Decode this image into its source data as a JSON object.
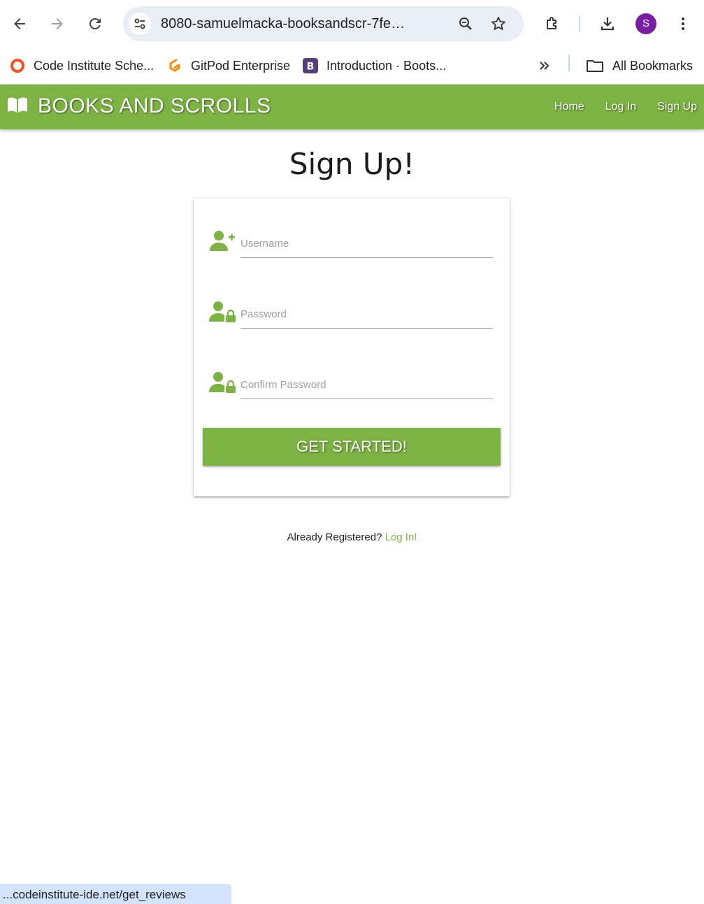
{
  "browser": {
    "url": "8080-samuelmacka-booksandscr-7fenczjre...",
    "profile_initial": "S",
    "bookmarks": [
      {
        "label": "Code Institute Sche...",
        "icon": "code-institute-icon"
      },
      {
        "label": "GitPod Enterprise",
        "icon": "gitpod-icon"
      },
      {
        "label": "Introduction · Boots...",
        "icon": "bootstrap-icon"
      }
    ],
    "all_bookmarks_label": "All Bookmarks",
    "status_url": "...codeinstitute-ide.net/get_reviews"
  },
  "site": {
    "brand": "BOOKS AND SCROLLS",
    "nav": [
      {
        "label": "Home"
      },
      {
        "label": "Log In"
      },
      {
        "label": "Sign Up"
      }
    ],
    "accent_color": "#7cb342"
  },
  "form": {
    "title": "Sign Up!",
    "username_placeholder": "Username",
    "password_placeholder": "Password",
    "confirm_placeholder": "Confirm Password",
    "submit_label": "GET STARTED!",
    "already_text": "Already Registered?",
    "login_link": "Log In!"
  }
}
